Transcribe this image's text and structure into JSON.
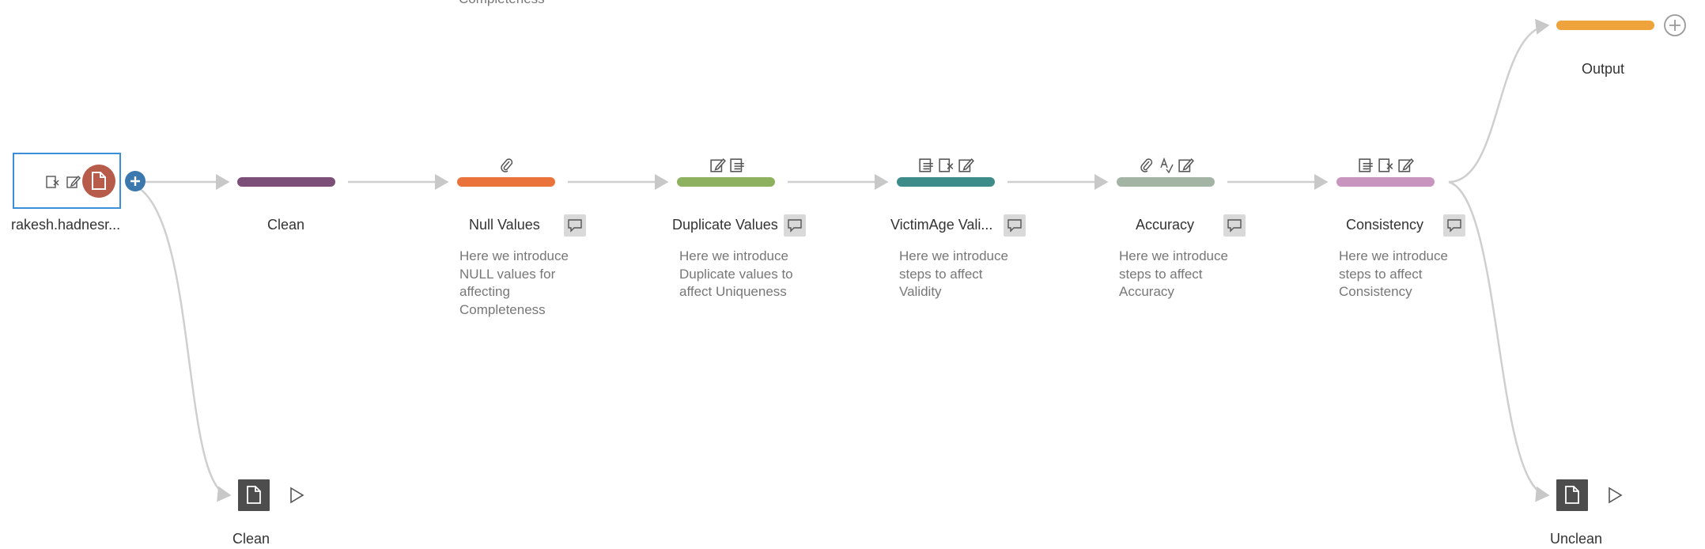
{
  "top_cut_text": "Completeness",
  "input_node": {
    "label": "rakesh.hadnesr..."
  },
  "steps": [
    {
      "id": "clean",
      "label": "Clean",
      "color": "#7b4f77",
      "icons": [],
      "comment": false,
      "description": ""
    },
    {
      "id": "null-values",
      "label": "Null Values",
      "color": "#e9733b",
      "icons": [
        "paperclip-icon"
      ],
      "comment": true,
      "description": "Here we introduce NULL values for affecting Completeness"
    },
    {
      "id": "duplicate-values",
      "label": "Duplicate Values",
      "color": "#8db15f",
      "icons": [
        "edit-icon",
        "list-icon"
      ],
      "comment": true,
      "description": "Here we introduce Duplicate values to affect Uniqueness"
    },
    {
      "id": "victimage-validity",
      "label": "VictimAge Vali...",
      "color": "#3e8c8a",
      "icons": [
        "list-icon",
        "remove-field-icon",
        "edit-icon"
      ],
      "comment": true,
      "description": "Here we introduce steps to affect Validity"
    },
    {
      "id": "accuracy",
      "label": "Accuracy",
      "color": "#a3b4a5",
      "icons": [
        "paperclip-icon",
        "spell-icon",
        "edit-icon"
      ],
      "comment": true,
      "description": "Here we introduce steps to affect Accuracy"
    },
    {
      "id": "consistency",
      "label": "Consistency",
      "color": "#c895bf",
      "icons": [
        "list-icon",
        "remove-field-icon",
        "edit-icon"
      ],
      "comment": true,
      "description": "Here we introduce steps to affect Consistency"
    }
  ],
  "output_step": {
    "label": "Output",
    "color": "#efa33c"
  },
  "outputs": [
    {
      "id": "clean",
      "label": "Clean"
    },
    {
      "id": "unclean",
      "label": "Unclean"
    }
  ]
}
